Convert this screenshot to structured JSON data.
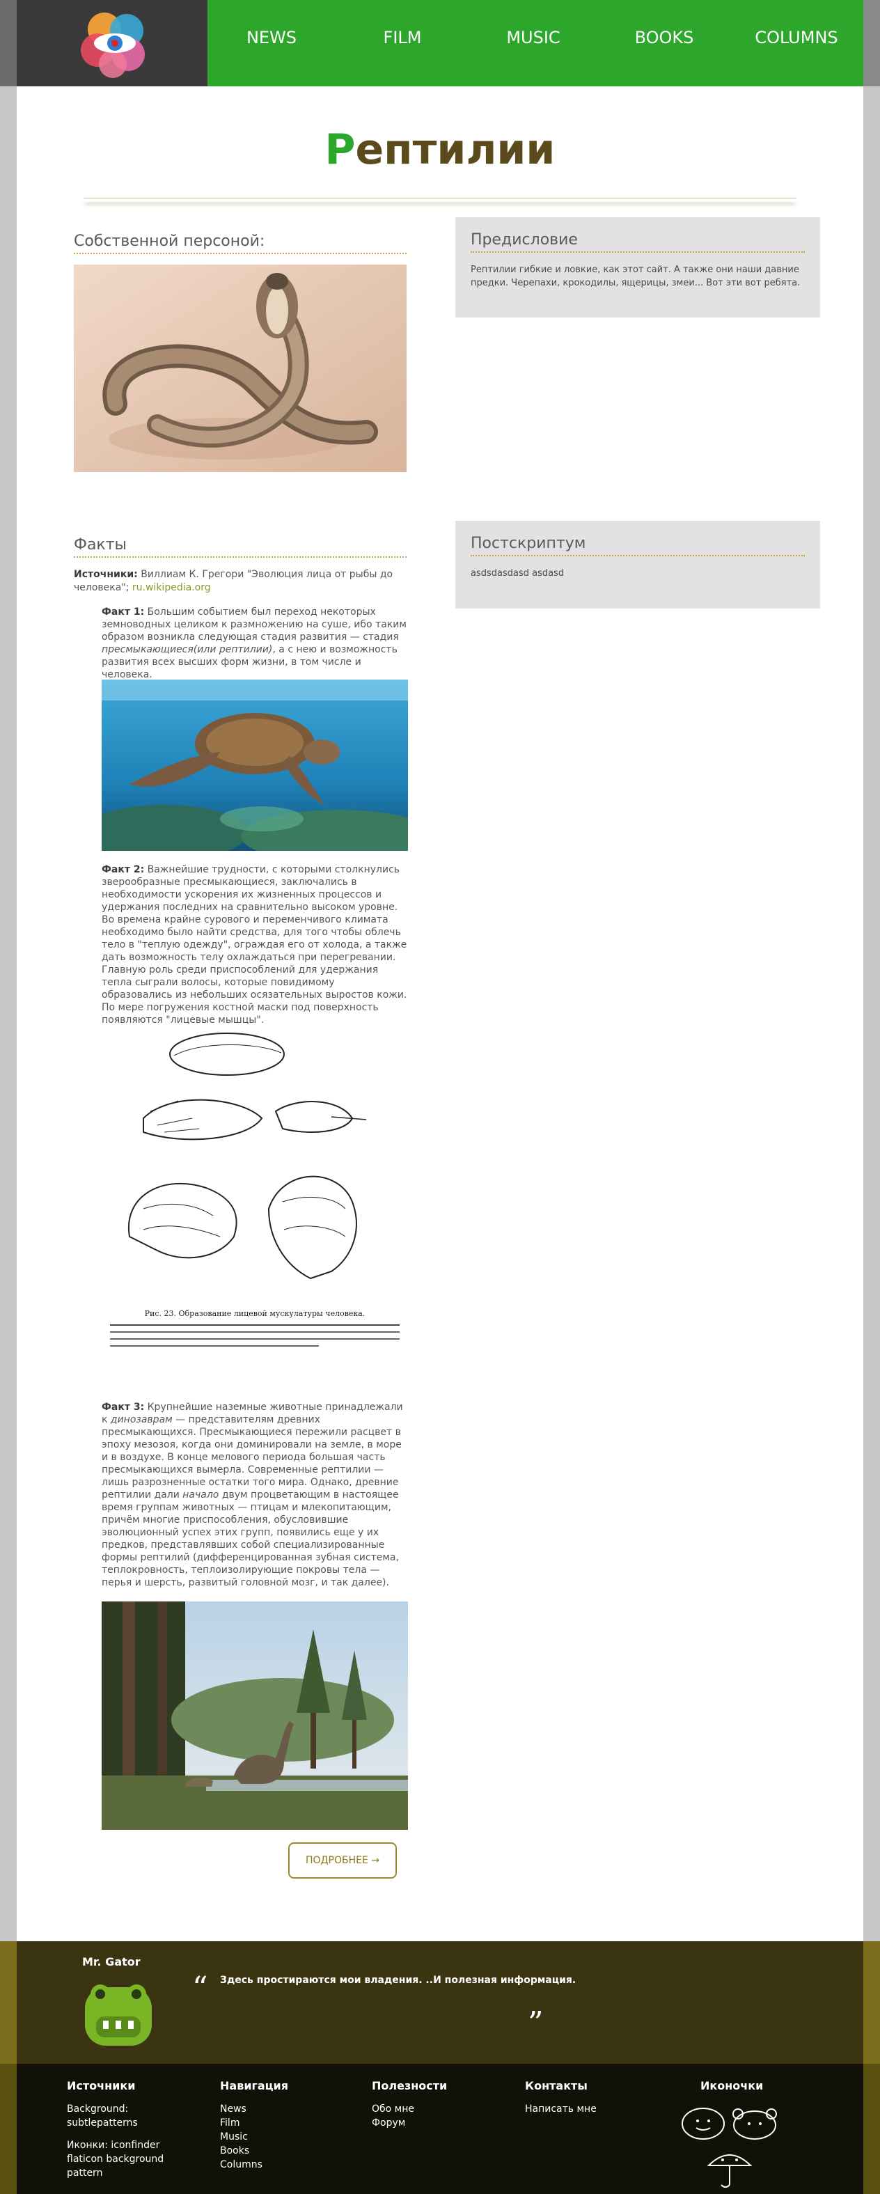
{
  "header": {
    "logo_icon": "eye-petals-logo",
    "nav": [
      "NEWS",
      "FILM",
      "MUSIC",
      "BOOKS",
      "COLUMNS"
    ],
    "colors": {
      "green": "#2ca72b",
      "dark": "#3a3a3a"
    }
  },
  "page": {
    "title_first": "Р",
    "title_rest": "ептилии"
  },
  "left": {
    "section1_heading": "Собственной персоной:",
    "section2_heading": "Факты",
    "sources_label": "Источники:",
    "sources_text": " Виллиам К. Грегори \"Эволюция лица от рыбы до человека\"; ",
    "sources_link": "ru.wikipedia.org",
    "fact1_label": "Факт 1:",
    "fact1_a": " Большим событием был переход некоторых земноводных целиком к размножению на суше, ибо таким образом возникла следующая стадия развития — стадия ",
    "fact1_em": "пресмыкающиеся(или рептилии)",
    "fact1_b": ", а с нею и возможность развития всех высших форм жизни, в том числе и человека.",
    "fact2_label": "Факт 2:",
    "fact2_text": " Важнейшие трудности, с которыми столкнулись зверообразные пресмыкающиеся, заключались в необходимости ускорения их жизненных процессов и удержания последних на сравнительно высоком уровне. Во времена крайне сурового и переменчивого климата необходимо было найти средства, для того чтобы облечь тело в \"теплую одежду\", ограждая его от холода, а также дать возможность телу охлаждаться при перегревании. Главную роль среди приспособлений для удержания тепла сыграли волосы, которые повидимому образовались из небольших осязательных выростов кожи. По мере погружения костной маски под поверхность появляются \"лицевые мышцы\".",
    "figure_caption": "Рис. 23. Образование лицевой мускулатуры человека.",
    "fact3_label": "Факт 3:",
    "fact3_a": " Крупнейшие наземные животные принадлежали к ",
    "fact3_em1": "динозаврам",
    "fact3_b": " — представителям древних пресмыкающихся. Пресмыкающиеся пережили расцвет в эпоху мезозоя, когда они доминировали на земле, в море и в воздухе. В конце мелового периода большая часть пресмыкающихся вымерла. Современные рептилии — лишь разрозненные остатки того мира. Однако, древние рептилии дали ",
    "fact3_em2": "начало",
    "fact3_c": " двум процветающим в настоящее время группам животных — птицам и млекопитающим, причём многие приспособления, обусловившие эволюционный успех этих групп, появились еще у их предков, представлявших собой специализированные формы рептилий (дифференцированная зубная система, теплокровность, теплоизолирующие покровы тела — перья и шерсть, развитый головной мозг, и так далее).",
    "more_button": "ПОДРОБНЕЕ →"
  },
  "right": {
    "preface_title": "Предисловие",
    "preface_text": "Рептилии гибкие и ловкие, как этот сайт. А также они наши давние предки. Черепахи, крокодилы, ящерицы, змеи... Вот эти вот ребята.",
    "postscript_title": "Постскриптум",
    "postscript_text": "asdsdasdasd asdasd"
  },
  "footer": {
    "author": "Mr. Gator",
    "avatar_icon": "gator-avatar",
    "quote_open": "“",
    "quote_close": "”",
    "quote": "Здесь простираются мои владения. ..И полезная информация.",
    "cols": {
      "sources": {
        "title": "Источники",
        "items": [
          "Background:",
          "subtlepatterns",
          "Иконки: iconfinder",
          "flaticon background",
          "pattern"
        ]
      },
      "nav": {
        "title": "Навигация",
        "items": [
          "News",
          "Film",
          "Music",
          "Books",
          "Columns"
        ]
      },
      "useful": {
        "title": "Полезности",
        "items": [
          "Обо мне",
          "Форум"
        ]
      },
      "contacts": {
        "title": "Контакты",
        "items": [
          "Написать мне"
        ]
      },
      "icons": {
        "title": "Иконочки",
        "names": [
          "smiley-face-icon",
          "bear-face-icon",
          "umbrella-face-icon"
        ]
      }
    }
  }
}
